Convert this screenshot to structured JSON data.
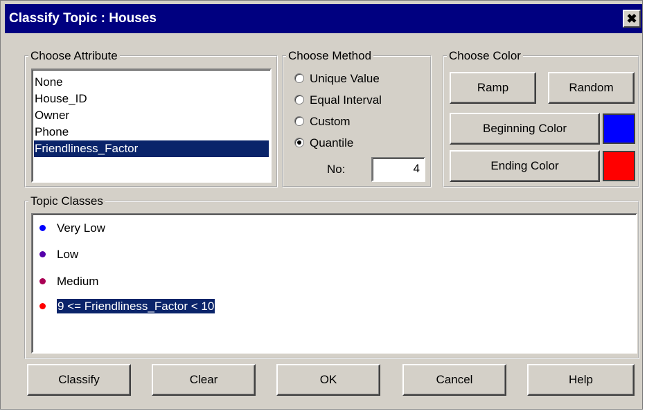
{
  "window": {
    "title": "Classify Topic : Houses",
    "close_label": "✖"
  },
  "choose_attribute": {
    "legend": "Choose Attribute",
    "items": [
      "None",
      "House_ID",
      "Owner",
      "Phone",
      "Friendliness_Factor"
    ],
    "selected_index": 4
  },
  "choose_method": {
    "legend": "Choose Method",
    "options": [
      "Unique Value",
      "Equal Interval",
      "Custom",
      "Quantile"
    ],
    "selected": "Quantile",
    "no_label": "No:",
    "no_value": "4"
  },
  "choose_color": {
    "legend": "Choose Color",
    "ramp_label": "Ramp",
    "random_label": "Random",
    "beginning_label": "Beginning Color",
    "ending_label": "Ending Color",
    "beginning_color": "#0000ff",
    "ending_color": "#ff0000"
  },
  "topic_classes": {
    "legend": "Topic Classes",
    "items": [
      {
        "label": "Very Low",
        "color": "#0000ff"
      },
      {
        "label": "Low",
        "color": "#5500aa"
      },
      {
        "label": "Medium",
        "color": "#aa0055"
      },
      {
        "label": "9 <= Friendliness_Factor < 10",
        "color": "#ff0000",
        "selected": true
      }
    ]
  },
  "buttons": {
    "classify": "Classify",
    "clear": "Clear",
    "ok": "OK",
    "cancel": "Cancel",
    "help": "Help"
  }
}
